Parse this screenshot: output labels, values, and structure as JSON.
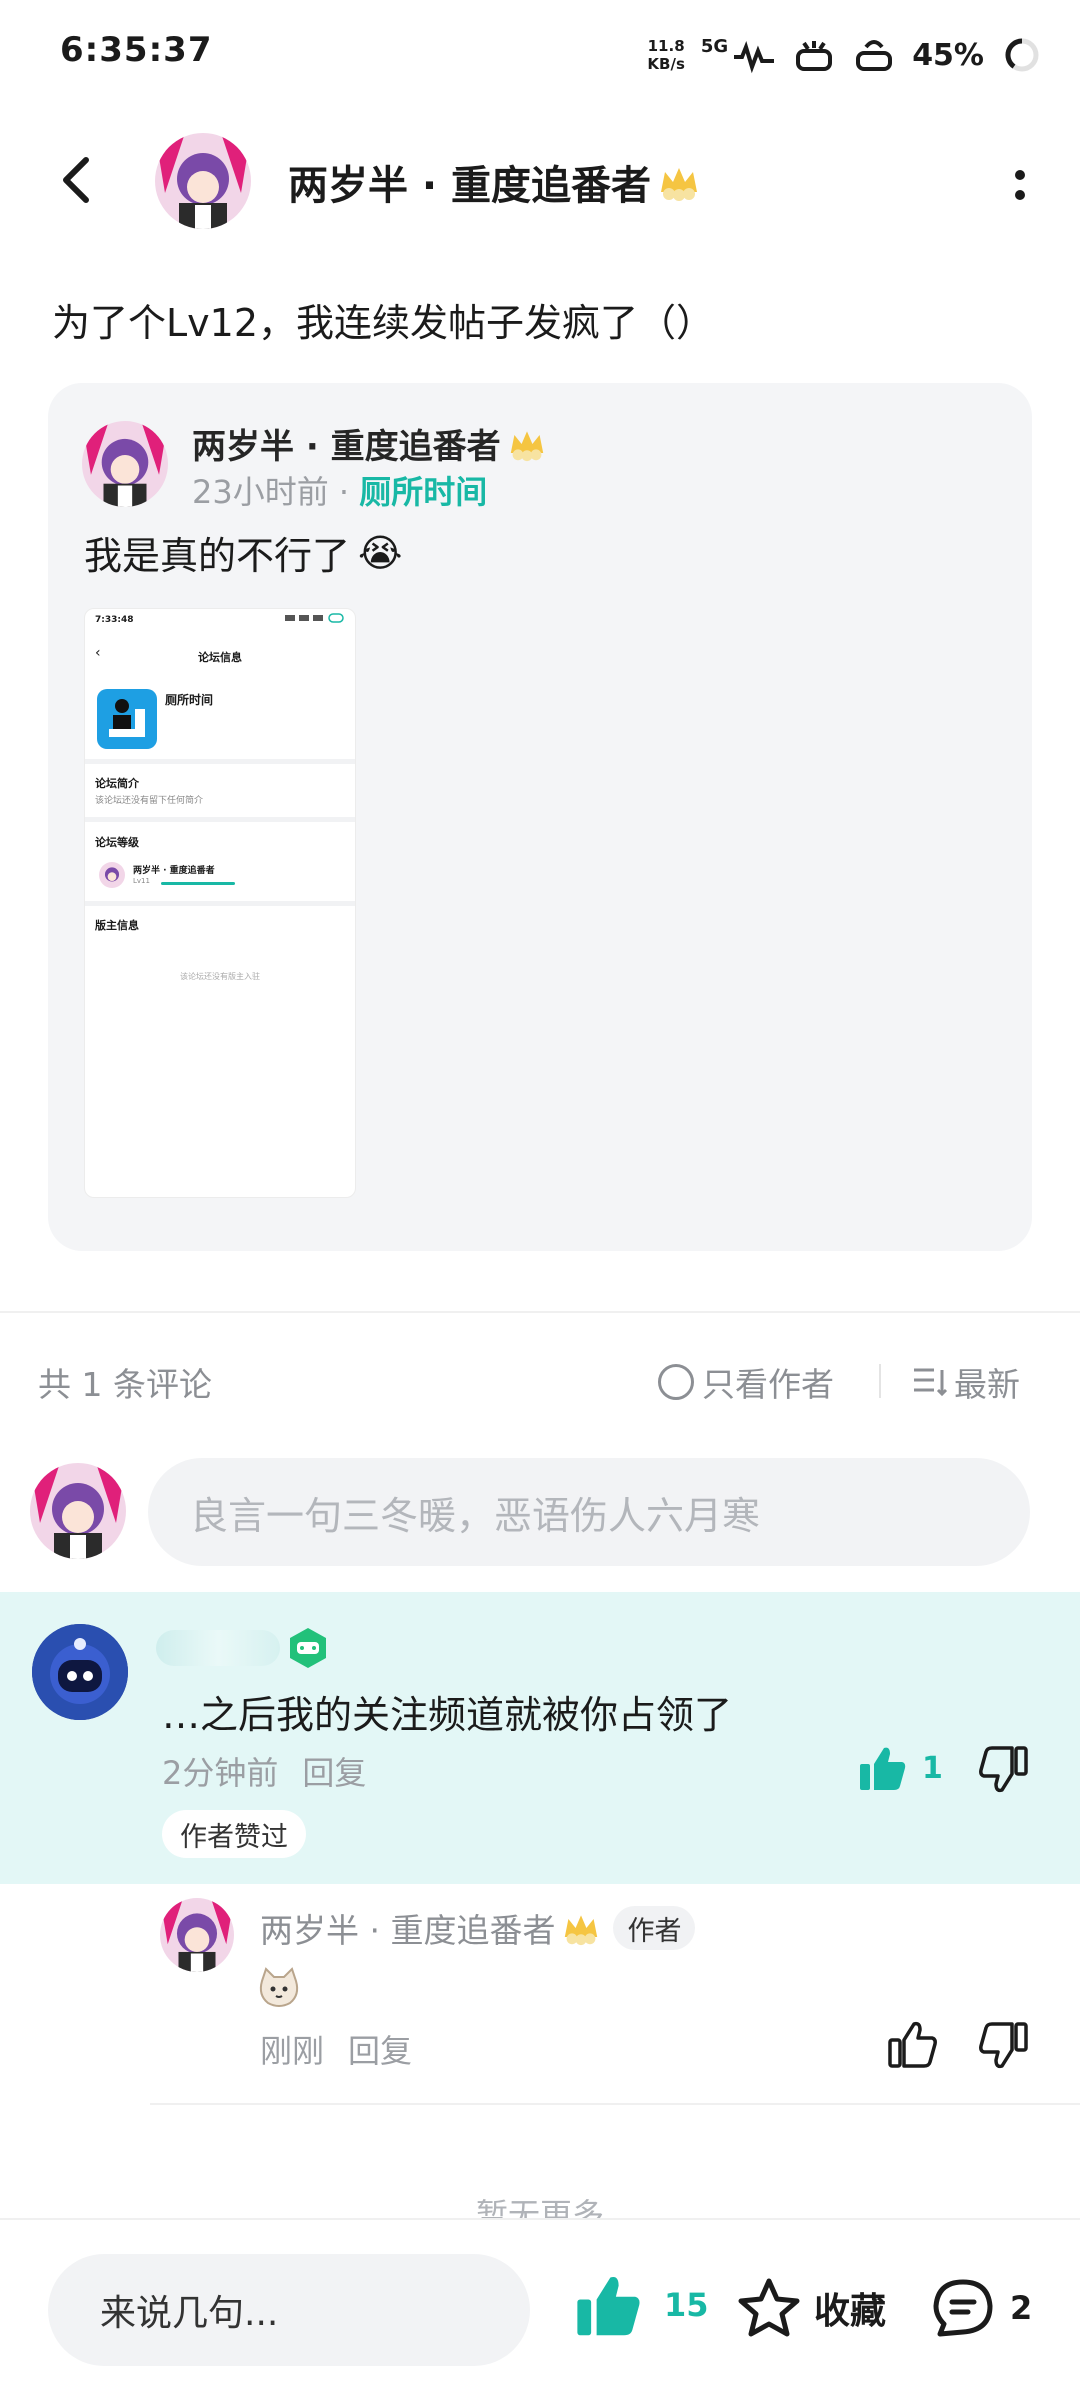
{
  "status_bar": {
    "time": "6:35:37",
    "net_speed_value": "11.8",
    "net_speed_unit": "KB/s",
    "network": "5G",
    "battery": "45%"
  },
  "header": {
    "author_name": "两岁半 · 重度追番者"
  },
  "post": {
    "title": "为了个Lv12，我连续发帖子发疯了（）"
  },
  "shared_card": {
    "author_name": "两岁半 · 重度追番者",
    "time": "23小时前",
    "dot": "·",
    "forum": "厕所时间",
    "body": "我是真的不行了",
    "body_emoji": "😭",
    "screenshot": {
      "time": "7:33:48",
      "page_title": "论坛信息",
      "forum_name": "厕所时间",
      "intro_label": "论坛简介",
      "intro_text": "该论坛还没有留下任何简介",
      "level_label": "论坛等级",
      "user_name": "两岁半 · 重度追番者",
      "user_level": "Lv11",
      "moderator_label": "版主信息",
      "moderator_text": "该论坛还没有版主入驻"
    }
  },
  "comments_bar": {
    "count_text": "共 1 条评论",
    "author_only": "只看作者",
    "sort": "最新"
  },
  "comment_input": {
    "placeholder": "良言一句三冬暖，恶语伤人六月寒"
  },
  "comments": [
    {
      "text": "…之后我的关注频道就被你占领了",
      "time": "2分钟前",
      "reply_label": "回复",
      "likes": "1",
      "tag": "作者赞过",
      "replies": [
        {
          "author_name": "两岁半 · 重度追番者",
          "author_tag": "作者",
          "time": "刚刚",
          "reply_label": "回复"
        }
      ]
    }
  ],
  "footer_note": "暂无更多",
  "bottom_bar": {
    "input_placeholder": "来说几句...",
    "like_count": "15",
    "favorite_label": "收藏",
    "comment_count": "2"
  },
  "colors": {
    "accent": "#18b8a5",
    "highlight_bg": "#e3f7f6",
    "card_bg": "#f4f5f7"
  }
}
